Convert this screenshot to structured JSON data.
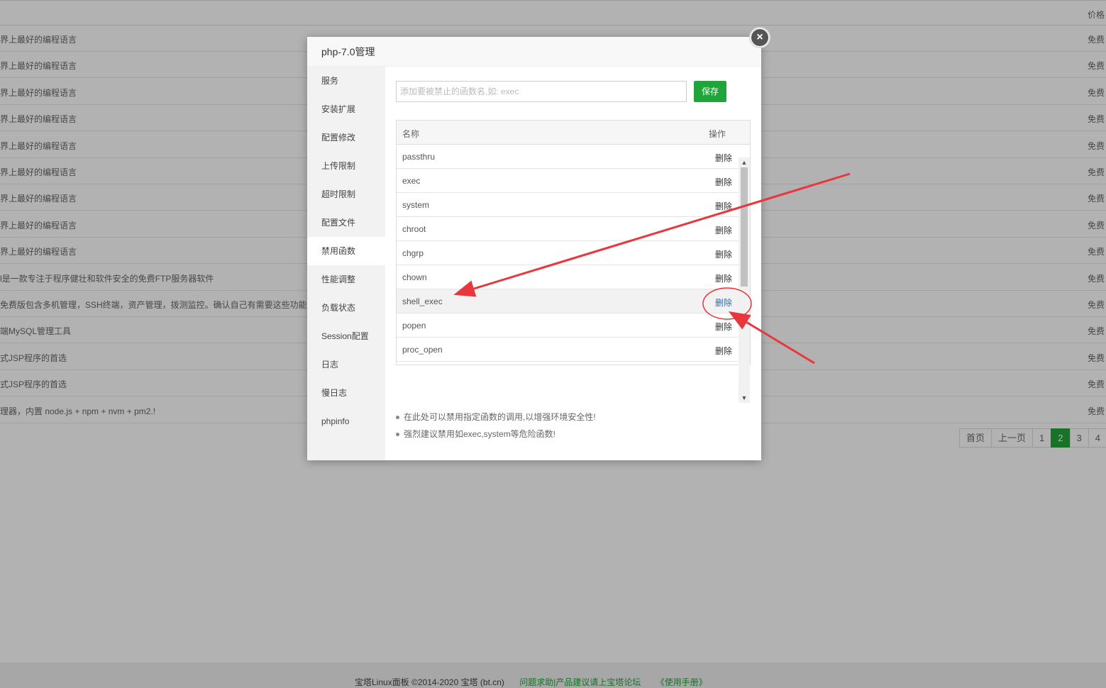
{
  "background": {
    "header_price": "价格",
    "rows": [
      {
        "desc": "界上最好的编程语言",
        "fee": "免费"
      },
      {
        "desc": "界上最好的编程语言",
        "fee": "免费"
      },
      {
        "desc": "界上最好的编程语言",
        "fee": "免费"
      },
      {
        "desc": "界上最好的编程语言",
        "fee": "免费"
      },
      {
        "desc": "界上最好的编程语言",
        "fee": "免费"
      },
      {
        "desc": "界上最好的编程语言",
        "fee": "免费"
      },
      {
        "desc": "界上最好的编程语言",
        "fee": "免费"
      },
      {
        "desc": "界上最好的编程语言",
        "fee": "免费"
      },
      {
        "desc": "界上最好的编程语言",
        "fee": "免费"
      },
      {
        "desc": "l是一款专注于程序健壮和软件安全的免费FTP服务器软件",
        "fee": "免费"
      },
      {
        "desc": "免费版包含多机管理，SSH终端，资产管理，拨测监控。确认自己有需要这些功能才",
        "fee": "免费"
      },
      {
        "desc": "端MySQL管理工具",
        "fee": "免费"
      },
      {
        "desc": "式JSP程序的首选",
        "fee": "免费"
      },
      {
        "desc": "式JSP程序的首选",
        "fee": "免费"
      },
      {
        "desc": "理器，内置 node.js + npm + nvm + pm2.!",
        "fee": "免费"
      }
    ],
    "pagination": {
      "first": "首页",
      "prev": "上一页",
      "p1": "1",
      "p2": "2",
      "p3": "3",
      "p4": "4"
    },
    "footer": {
      "copyright": "宝塔Linux面板 ©2014-2020 宝塔 (bt.cn)",
      "forum": "问题求助|产品建议请上宝塔论坛",
      "manual": "《使用手册》"
    }
  },
  "modal": {
    "title": "php-7.0管理",
    "close_icon": "close-icon",
    "menu": [
      "服务",
      "安装扩展",
      "配置修改",
      "上传限制",
      "超时限制",
      "配置文件",
      "禁用函数",
      "性能调整",
      "负载状态",
      "Session配置",
      "日志",
      "慢日志",
      "phpinfo"
    ],
    "active_menu": "禁用函数",
    "input_placeholder": "添加要被禁止的函数名,如: exec",
    "save_label": "保存",
    "table": {
      "col_name": "名称",
      "col_op": "操作",
      "rows": [
        {
          "name": "passthru",
          "action": "删除"
        },
        {
          "name": "exec",
          "action": "删除"
        },
        {
          "name": "system",
          "action": "删除"
        },
        {
          "name": "chroot",
          "action": "删除"
        },
        {
          "name": "chgrp",
          "action": "删除"
        },
        {
          "name": "chown",
          "action": "删除"
        },
        {
          "name": "shell_exec",
          "action": "删除"
        },
        {
          "name": "popen",
          "action": "删除"
        },
        {
          "name": "proc_open",
          "action": "删除"
        }
      ],
      "highlighted_row": "shell_exec"
    },
    "tips": [
      "在此处可以禁用指定函数的调用,以增强环境安全性!",
      "强烈建议禁用如exec,system等危险函数!"
    ]
  },
  "colors": {
    "accent": "#20a53a",
    "annotation": "#e8373d",
    "link": "#2a6dbb"
  }
}
